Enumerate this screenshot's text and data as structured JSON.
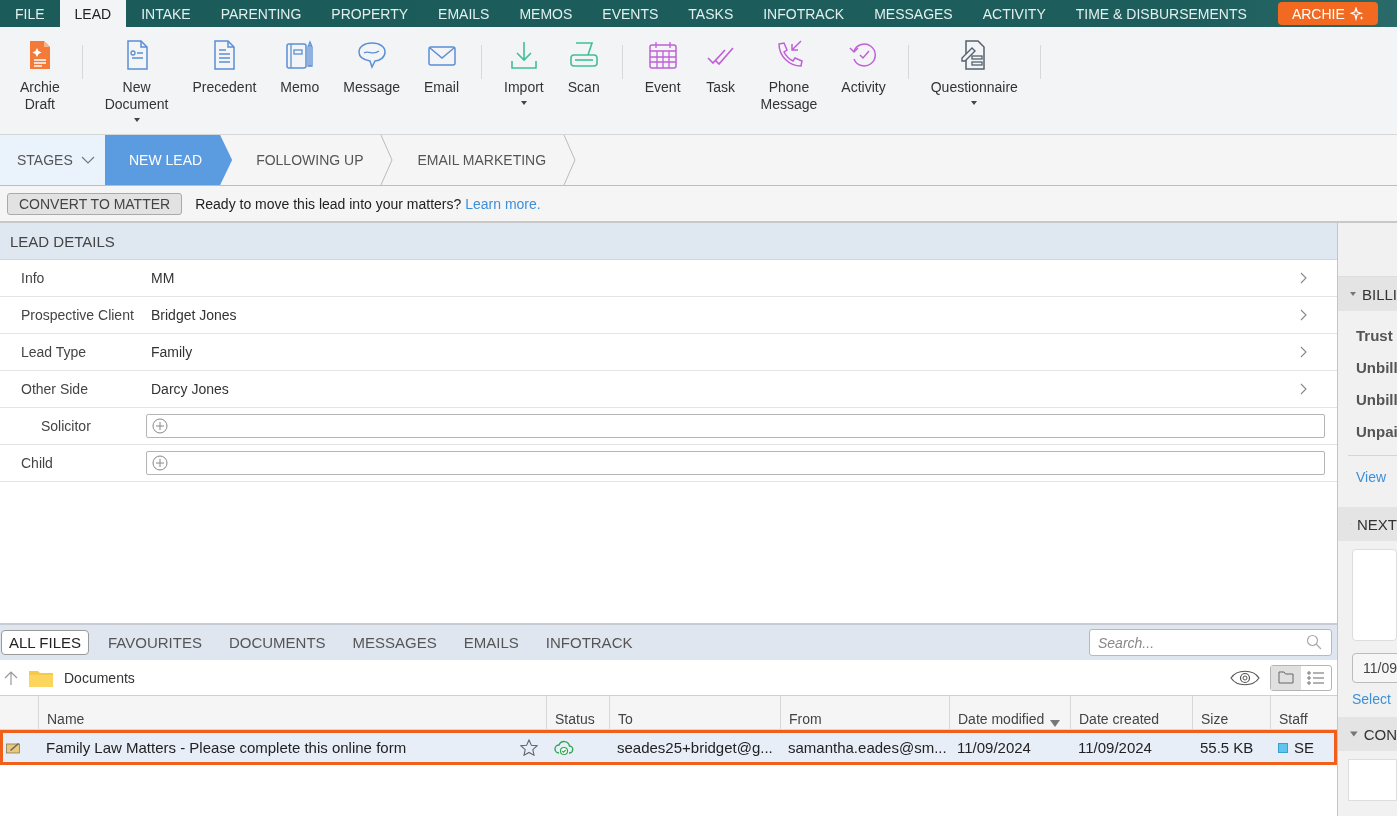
{
  "menu_tabs": [
    {
      "label": "FILE",
      "selected": false
    },
    {
      "label": "LEAD",
      "selected": true
    },
    {
      "label": "INTAKE",
      "selected": false
    },
    {
      "label": "PARENTING",
      "selected": false
    },
    {
      "label": "PROPERTY",
      "selected": false
    },
    {
      "label": "EMAILS",
      "selected": false
    },
    {
      "label": "MEMOS",
      "selected": false
    },
    {
      "label": "EVENTS",
      "selected": false
    },
    {
      "label": "TASKS",
      "selected": false
    },
    {
      "label": "INFOTRACK",
      "selected": false
    },
    {
      "label": "MESSAGES",
      "selected": false
    },
    {
      "label": "ACTIVITY",
      "selected": false
    },
    {
      "label": "TIME & DISBURSEMENTS",
      "selected": false
    }
  ],
  "archie_button": {
    "label": "ARCHIE"
  },
  "ribbon_groups": [
    [
      {
        "label": "Archie Draft",
        "dropdown": false
      }
    ],
    [
      {
        "label": "New Document",
        "dropdown": true
      },
      {
        "label": "Precedent",
        "dropdown": false
      },
      {
        "label": "Memo",
        "dropdown": false
      },
      {
        "label": "Message",
        "dropdown": false
      },
      {
        "label": "Email",
        "dropdown": false
      }
    ],
    [
      {
        "label": "Import",
        "dropdown": true
      },
      {
        "label": "Scan",
        "dropdown": false
      }
    ],
    [
      {
        "label": "Event",
        "dropdown": false
      },
      {
        "label": "Task",
        "dropdown": false
      },
      {
        "label": "Phone Message",
        "dropdown": false
      },
      {
        "label": "Activity",
        "dropdown": false
      }
    ],
    [
      {
        "label": "Questionnaire",
        "dropdown": true
      }
    ]
  ],
  "stages": {
    "label": "STAGES",
    "items": [
      {
        "label": "NEW LEAD",
        "selected": true
      },
      {
        "label": "FOLLOWING UP",
        "selected": false
      },
      {
        "label": "EMAIL MARKETING",
        "selected": false
      }
    ]
  },
  "convert_bar": {
    "button": "CONVERT TO MATTER",
    "message": "Ready to move this lead into your matters?",
    "link": "Learn more."
  },
  "lead_details": {
    "title": "LEAD DETAILS",
    "fields": [
      {
        "label": "Info",
        "value": "MM",
        "kind": "link"
      },
      {
        "label": "Prospective Client",
        "value": "Bridget Jones",
        "kind": "link"
      },
      {
        "label": "Lead Type",
        "value": "Family",
        "kind": "link"
      },
      {
        "label": "Other Side",
        "value": "Darcy Jones",
        "kind": "link",
        "children": [
          {
            "label": "Solicitor",
            "kind": "add"
          }
        ]
      },
      {
        "label": "Child",
        "kind": "add"
      }
    ]
  },
  "files": {
    "tabs": [
      {
        "label": "ALL FILES",
        "selected": true
      },
      {
        "label": "FAVOURITES",
        "selected": false
      },
      {
        "label": "DOCUMENTS",
        "selected": false
      },
      {
        "label": "MESSAGES",
        "selected": false
      },
      {
        "label": "EMAILS",
        "selected": false
      },
      {
        "label": "INFOTRACK",
        "selected": false
      }
    ],
    "search": {
      "placeholder": "Search..."
    },
    "folder": "Documents",
    "views": [
      {
        "kind": "folder",
        "selected": true
      },
      {
        "kind": "list",
        "selected": false
      }
    ],
    "columns": [
      {
        "label": "Name"
      },
      {
        "label": "Status"
      },
      {
        "label": "To"
      },
      {
        "label": "From"
      },
      {
        "label": "Date modified",
        "sorted": true
      },
      {
        "label": "Date created"
      },
      {
        "label": "Size"
      },
      {
        "label": "Staff"
      }
    ],
    "rows": [
      {
        "name": "Family Law Matters - Please complete this online form",
        "starred": false,
        "highlighted": true,
        "to": "seades25+bridget@g...",
        "from": "samantha.eades@sm...",
        "date_modified": "11/09/2024",
        "date_created": "11/09/2024",
        "size": "55.5 KB",
        "staff": "SE",
        "color": "#5ec6ee"
      }
    ]
  },
  "side_panel": [
    {
      "kind": "list",
      "title": "BILLI",
      "expanded": true,
      "items": [
        "Trust",
        "Unbill",
        "Unbill",
        "Unpai"
      ],
      "link": "View"
    },
    {
      "kind": "note",
      "title": "NEXT",
      "expanded": true,
      "date": "11/09",
      "link": "Select"
    },
    {
      "kind": "box",
      "title": "CON",
      "expanded": true
    }
  ]
}
